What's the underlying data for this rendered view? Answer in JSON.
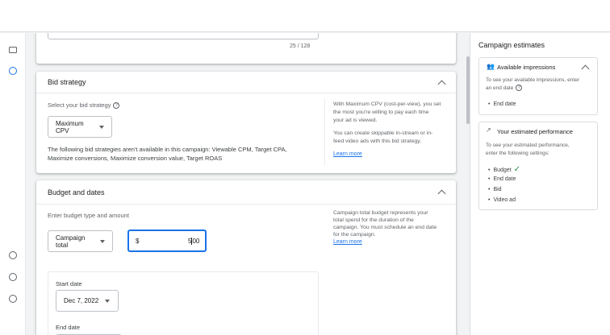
{
  "title_counter": "25 / 128",
  "bid_strategy": {
    "title": "Bid strategy",
    "select_label": "Select your bid strategy",
    "selected": "Maximum CPV",
    "unavailable_line1": "The following bid strategies aren't available in this campaign: Viewable CPM, Target CPA,",
    "unavailable_line2": "Maximize conversions, Maximize conversion value, Target ROAS",
    "info_lines": [
      "With Maximum CPV (cost-per-view), you set",
      "the most you're willing to pay each time",
      "your ad is viewed."
    ],
    "info_lines2": [
      "You can create skippable in-stream or in-",
      "feed video ads with this bid strategy."
    ],
    "learn_more": "Learn more"
  },
  "budget": {
    "title": "Budget and dates",
    "type_label": "Enter budget type and amount",
    "type_selected": "Campaign total",
    "currency": "$",
    "amount_before_cursor": "5",
    "amount_after_cursor": "00",
    "info_lines": [
      "Campaign total budget represents your",
      "total spend for the duration of the",
      "campaign. You must schedule an end date",
      "for the campaign."
    ],
    "learn_more": "Learn more",
    "start_label": "Start date",
    "start_value": "Dec 7, 2022",
    "end_label": "End date"
  },
  "estimates": {
    "title": "Campaign estimates",
    "impressions": {
      "title": "Available impressions",
      "text1": "To see your available impressions, enter",
      "text2": "an end date",
      "items": [
        "End date"
      ]
    },
    "performance": {
      "title": "Your estimated performance",
      "text1": "To see your estimated performance,",
      "text2": "enter the following settings:",
      "items": [
        "Budget",
        "End date",
        "Bid",
        "Video ad"
      ]
    }
  },
  "colors": {
    "accent": "#1a73e8",
    "check": "#1e8e3e"
  }
}
